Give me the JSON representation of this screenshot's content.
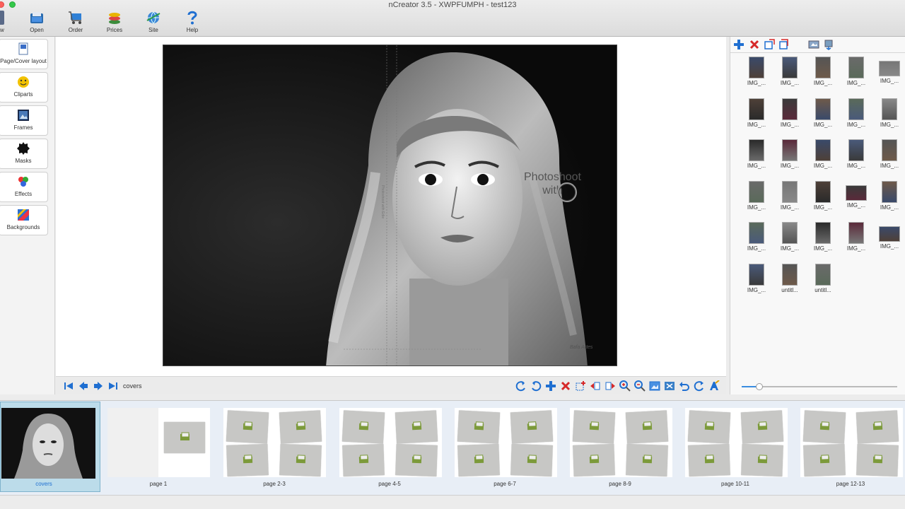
{
  "window": {
    "title": "nCreator 3.5 - XWPFUMPH - test123"
  },
  "toolbar": {
    "partial_label": "w",
    "buttons": [
      {
        "label": "Open",
        "icon": "open-icon"
      },
      {
        "label": "Order",
        "icon": "cart-icon"
      },
      {
        "label": "Prices",
        "icon": "coins-icon"
      },
      {
        "label": "Site",
        "icon": "globe-icon"
      },
      {
        "label": "Help",
        "icon": "question-icon"
      }
    ]
  },
  "tools": [
    {
      "label": "Page/Cover layout",
      "icon": "layout-icon"
    },
    {
      "label": "Cliparts",
      "icon": "clipart-icon"
    },
    {
      "label": "Frames",
      "icon": "frame-icon"
    },
    {
      "label": "Masks",
      "icon": "mask-icon"
    },
    {
      "label": "Effects",
      "icon": "effects-icon"
    },
    {
      "label": "Backgrounds",
      "icon": "backgrounds-icon"
    }
  ],
  "canvas": {
    "overlay_text_line1": "Photoshoot",
    "overlay_text_line2": "with",
    "spine_text": "Photoshoot with Edie",
    "signature": "Bafa Artes",
    "current_page": "covers"
  },
  "right_panel": {
    "photos": [
      "IMG_...",
      "IMG_...",
      "IMG_...",
      "IMG_...",
      "IMG_...",
      "IMG_...",
      "IMG_...",
      "IMG_...",
      "IMG_...",
      "IMG_...",
      "IMG_...",
      "IMG_...",
      "IMG_...",
      "IMG_...",
      "IMG_...",
      "IMG_...",
      "IMG_...",
      "IMG_...",
      "IMG_...",
      "IMG_...",
      "IMG_...",
      "IMG_...",
      "IMG_...",
      "IMG_...",
      "IMG_...",
      "IMG_...",
      "untitl...",
      "untitl..."
    ],
    "zoom_level": 0.1
  },
  "filmstrip": {
    "pages": [
      "covers",
      "page 1",
      "page 2-3",
      "page 4-5",
      "page 6-7",
      "page 8-9",
      "page 10-11",
      "page 12-13"
    ],
    "selected": "covers"
  },
  "colors": {
    "accent_blue": "#1f6fd1",
    "delete_red": "#d62828",
    "filmstrip_bg": "#e8eef6",
    "slot_gray": "#c7c7c5",
    "slot_icon_green": "#7c9a3a"
  }
}
